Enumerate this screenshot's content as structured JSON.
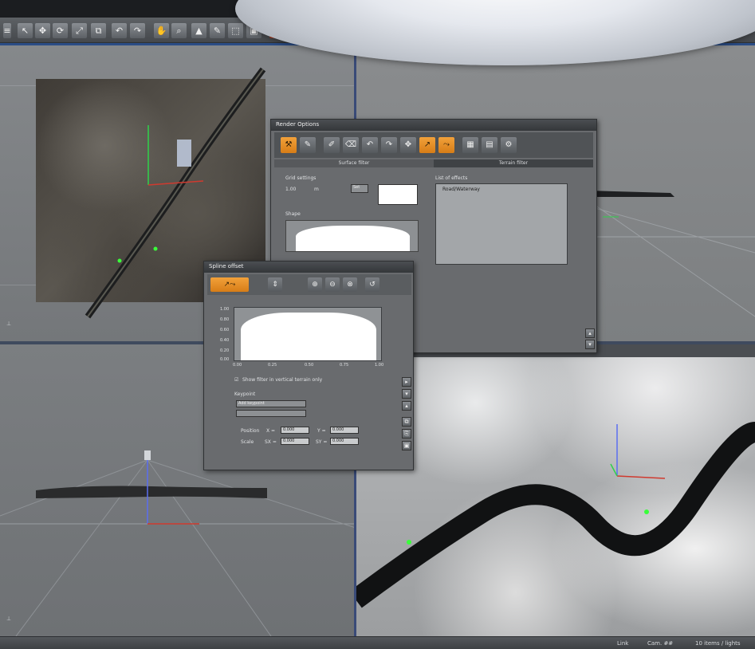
{
  "main_toolbar": {
    "icons": [
      "menu-icon",
      "cursor-icon",
      "move-icon",
      "rotate-icon",
      "scale-icon",
      "copy-icon",
      "undo-icon",
      "redo-icon",
      "pan-icon",
      "zoom-icon",
      "terrain-icon",
      "paint-icon",
      "select-icon",
      "frame-icon",
      "grid-icon",
      "render-icon",
      "settings-icon"
    ]
  },
  "render_panel": {
    "title": "Render Options",
    "tabs": [
      "Surface filter",
      "Terrain filter"
    ],
    "size_label": "Grid settings",
    "size_value": "1.00",
    "size_unit": "m",
    "apply_label": "Set",
    "shape_label": "Shape",
    "list_label": "List of effects",
    "list_items": [
      "Road/Waterway"
    ]
  },
  "spline_panel": {
    "title": "Spline offset",
    "graph_y_ticks": [
      "1.00",
      "0.80",
      "0.60",
      "0.40",
      "0.20",
      "0.00"
    ],
    "graph_x_ticks": [
      "0.00",
      "0.25",
      "0.50",
      "0.75",
      "1.00"
    ],
    "checkbox_label": "Show filter in vertical terrain only",
    "section_label": "Keypoint",
    "preset_button": "Add keypoint",
    "position_label": "Position",
    "scale_label": "Scale",
    "pos_x_label": "X =",
    "pos_x_value": "0.000",
    "pos_y_label": "Y =",
    "pos_y_value": "0.000",
    "scale_x_label": "SX =",
    "scale_x_value": "0.000",
    "scale_y_label": "SY =",
    "scale_y_value": "0.000"
  },
  "statusbar": {
    "mode": "Link",
    "fps": "Cam. ##",
    "right": "10 items / lights"
  }
}
